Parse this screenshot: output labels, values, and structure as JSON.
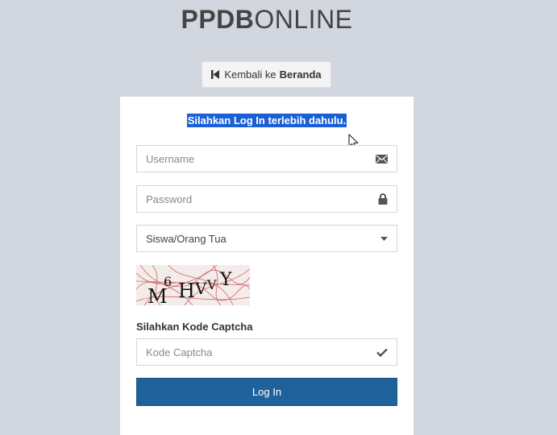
{
  "logo": {
    "bold": "PPDB",
    "thin": "ONLINE"
  },
  "back_button": {
    "prefix": "Kembali ke",
    "bold": "Beranda"
  },
  "login_box": {
    "message": "Silahkan Log In terlebih dahulu.",
    "username_placeholder": "Username",
    "password_placeholder": "Password",
    "role_select": {
      "selected": "Siswa/Orang Tua"
    },
    "captcha": {
      "text": "M6HVVY"
    },
    "captcha_label": "Silahkan Kode Captcha",
    "captcha_placeholder": "Kode Captcha",
    "login_label": "Log In"
  },
  "colors": {
    "page_bg": "#d2d6de",
    "selection": "#1a5fd6",
    "primary_button": "#1f629b"
  },
  "icons": [
    "step-backward-icon",
    "envelope-icon",
    "lock-icon",
    "caret-down-icon",
    "check-icon",
    "mouse-cursor-icon"
  ]
}
